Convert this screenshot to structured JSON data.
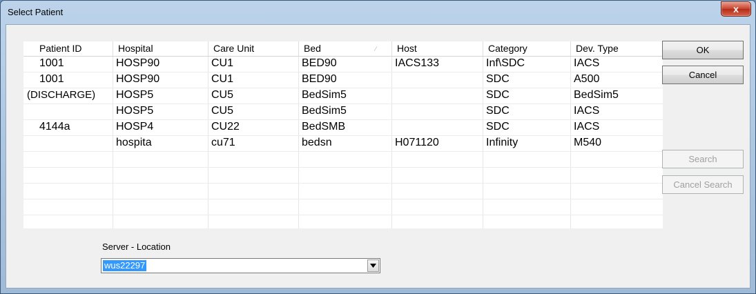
{
  "window": {
    "title": "Select Patient",
    "close_label": "x"
  },
  "table": {
    "columns": [
      "Patient ID",
      "Hospital",
      "Care Unit",
      "Bed",
      "Host",
      "Category",
      "Dev. Type"
    ],
    "rows": [
      [
        "1001",
        "HOSP90",
        "CU1",
        "BED90",
        "IACS133",
        "Inf\\SDC",
        "IACS"
      ],
      [
        "1001",
        "HOSP90",
        "CU1",
        "BED90",
        "",
        "SDC",
        "A500"
      ],
      [
        "(DISCHARGE)",
        "HOSP5",
        "CU5",
        "BedSim5",
        "",
        "SDC",
        "BedSim5"
      ],
      [
        "",
        "HOSP5",
        "CU5",
        "BedSim5",
        "",
        "SDC",
        "IACS"
      ],
      [
        "4144a",
        "HOSP4",
        "CU22",
        "BedSMB",
        "",
        "SDC",
        "IACS"
      ],
      [
        "",
        "hospita",
        "cu71",
        "bedsn",
        "H071120",
        "Infinity",
        "M540"
      ],
      [
        "",
        "",
        "",
        "",
        "",
        "",
        ""
      ],
      [
        "",
        "",
        "",
        "",
        "",
        "",
        ""
      ],
      [
        "",
        "",
        "",
        "",
        "",
        "",
        ""
      ],
      [
        "",
        "",
        "",
        "",
        "",
        "",
        ""
      ],
      [
        "",
        "",
        "",
        "",
        "",
        "",
        ""
      ]
    ],
    "sorted_column": "Bed"
  },
  "buttons": {
    "ok": "OK",
    "cancel": "Cancel",
    "search": "Search",
    "cancel_search": "Cancel Search"
  },
  "server": {
    "label": "Server - Location",
    "value": "wus22297"
  }
}
